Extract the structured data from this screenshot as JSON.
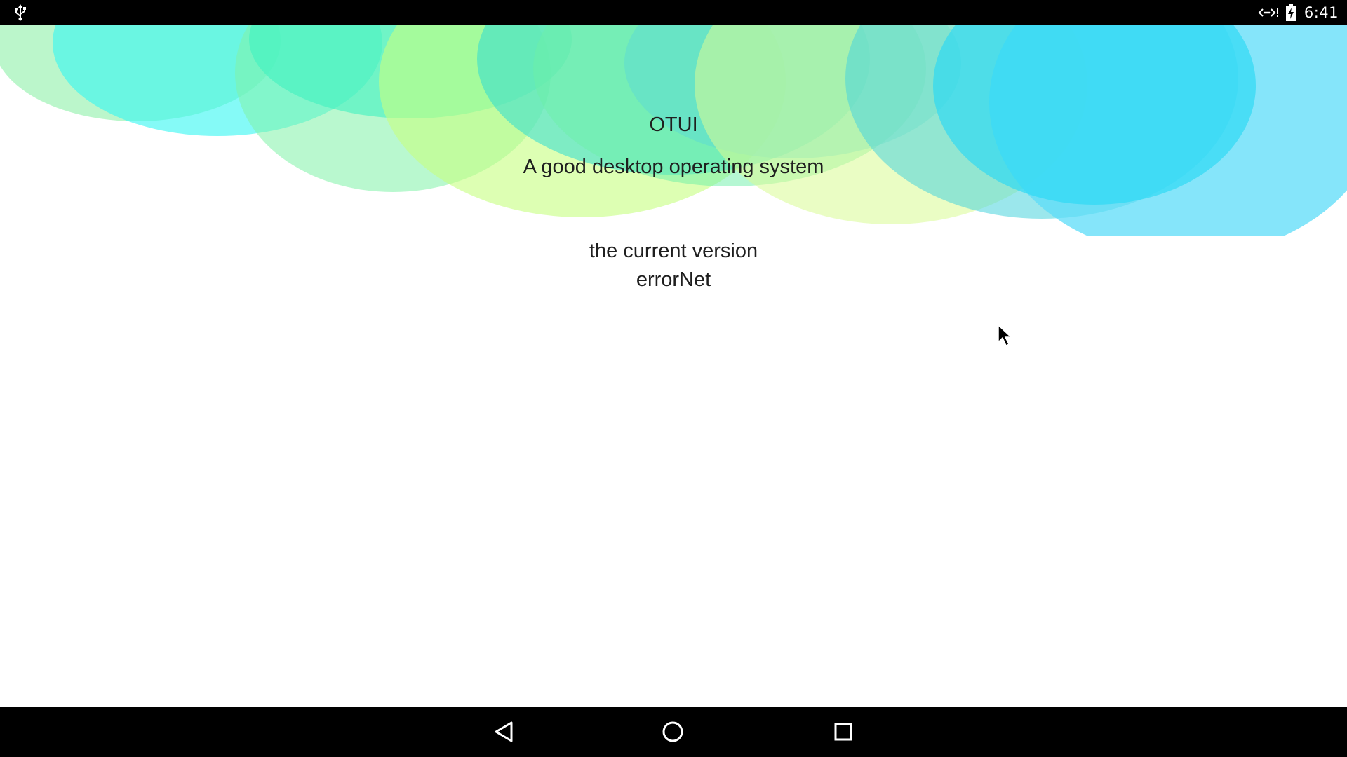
{
  "status_bar": {
    "left_icons": [
      "usb-icon"
    ],
    "right_icons": [
      "network-icon",
      "battery-charging-icon"
    ],
    "time": "6:41"
  },
  "main": {
    "title": "OTUI",
    "subtitle": "A good desktop operating system",
    "version_label": "the current version",
    "version_value": "errorNet"
  },
  "navigation_bar": {
    "buttons": [
      "back-icon",
      "home-icon",
      "recents-icon"
    ]
  },
  "colors": {
    "status_bar": "#000000",
    "background": "#ffffff",
    "text": "#1f1f1f",
    "bubble_cyan": "#3dd9f5",
    "bubble_green": "#7af0a8",
    "bubble_lime": "#d6f79a",
    "bubble_teal": "#3fe0c8"
  }
}
